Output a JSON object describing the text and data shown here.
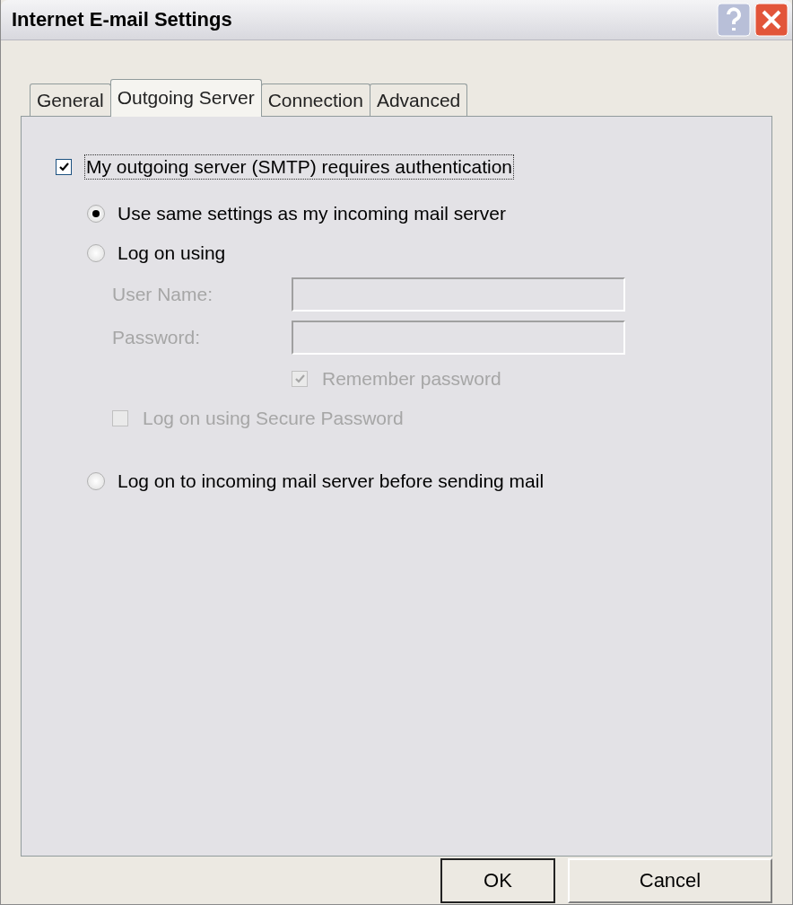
{
  "window": {
    "title": "Internet E-mail Settings"
  },
  "tabs": [
    {
      "label": "General",
      "selected": false
    },
    {
      "label": "Outgoing Server",
      "selected": true
    },
    {
      "label": "Connection",
      "selected": false
    },
    {
      "label": "Advanced",
      "selected": false
    }
  ],
  "auth": {
    "label": "My outgoing server (SMTP) requires authentication",
    "checked": true,
    "focused": true
  },
  "options": [
    {
      "kind": "radio",
      "label": "Use same settings as my incoming mail server",
      "selected": true,
      "disabled": false
    },
    {
      "kind": "radio",
      "label": "Log on using",
      "selected": false,
      "disabled": false
    },
    {
      "kind": "field",
      "label": "User Name:",
      "disabled": true
    },
    {
      "kind": "field",
      "label": "Password:",
      "disabled": true
    },
    {
      "kind": "field-checkbox",
      "label": "Remember password",
      "checked": true,
      "disabled": true
    },
    {
      "kind": "checkbox",
      "label": "Log on using Secure Password",
      "checked": false,
      "disabled": true
    },
    {
      "kind": "radio",
      "label": "Log on to incoming mail server before sending mail",
      "selected": false,
      "disabled": false
    }
  ],
  "buttons": [
    {
      "label": "OK",
      "default": true
    },
    {
      "label": "Cancel",
      "default": false
    }
  ]
}
